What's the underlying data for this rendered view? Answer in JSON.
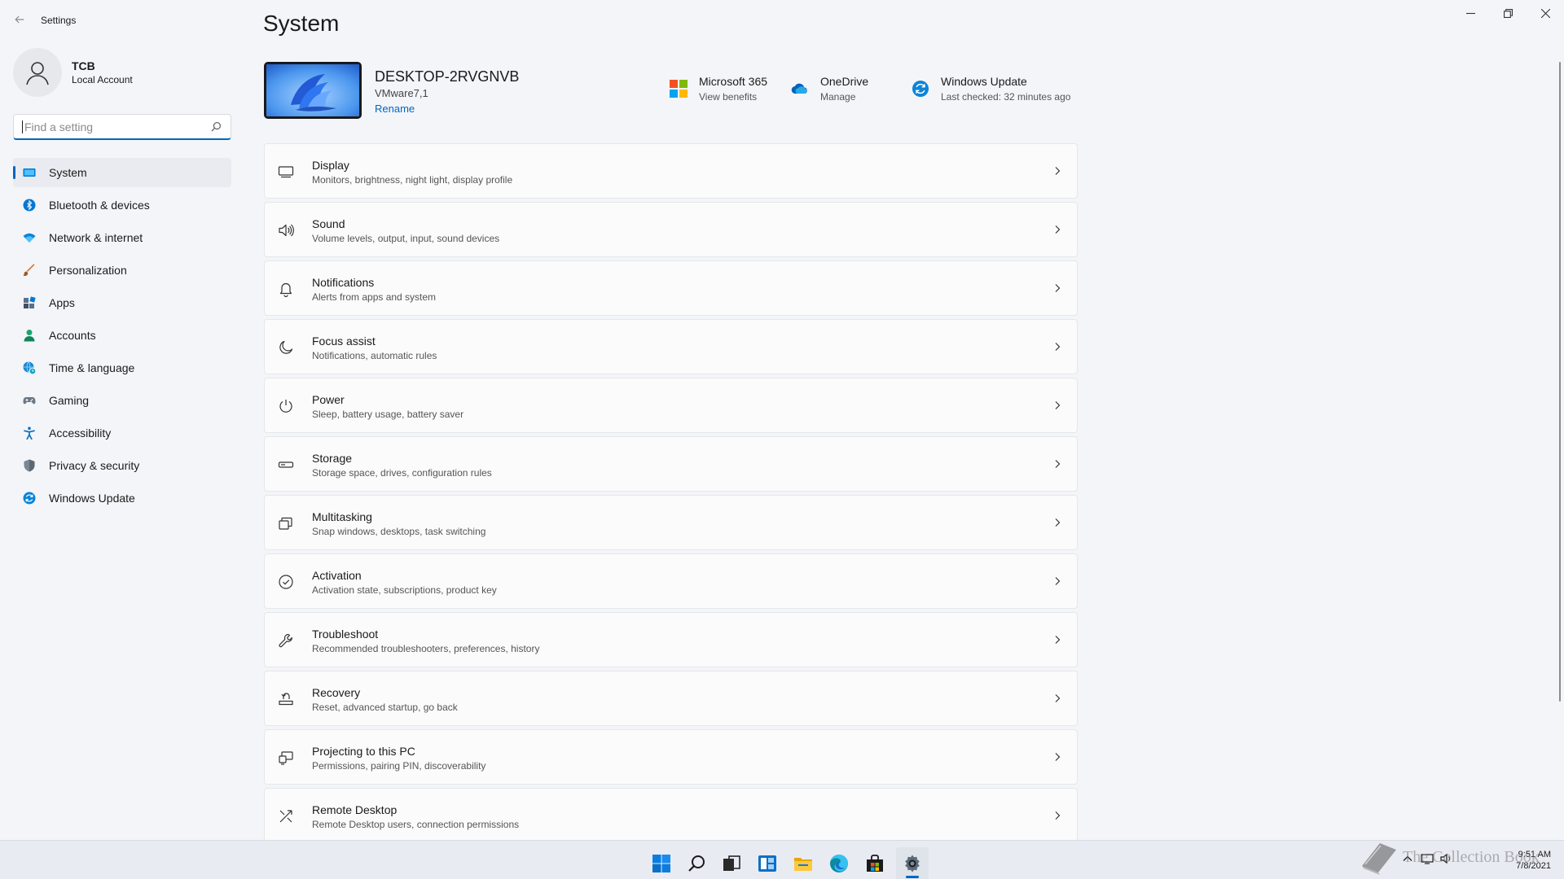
{
  "window": {
    "app_title": "Settings",
    "back_icon": "back-arrow-icon",
    "controls": [
      "minimize-icon",
      "restore-icon",
      "close-icon"
    ]
  },
  "profile": {
    "name": "TCB",
    "account_type": "Local Account",
    "icon": "user-avatar-icon"
  },
  "search": {
    "placeholder": "Find a setting",
    "icon": "search-icon"
  },
  "sidebar": {
    "items": [
      {
        "label": "System",
        "icon": "system-icon",
        "active": true
      },
      {
        "label": "Bluetooth & devices",
        "icon": "bluetooth-icon"
      },
      {
        "label": "Network & internet",
        "icon": "wifi-icon"
      },
      {
        "label": "Personalization",
        "icon": "brush-icon"
      },
      {
        "label": "Apps",
        "icon": "apps-icon"
      },
      {
        "label": "Accounts",
        "icon": "accounts-icon"
      },
      {
        "label": "Time & language",
        "icon": "globe-clock-icon"
      },
      {
        "label": "Gaming",
        "icon": "gamepad-icon"
      },
      {
        "label": "Accessibility",
        "icon": "accessibility-icon"
      },
      {
        "label": "Privacy & security",
        "icon": "shield-icon"
      },
      {
        "label": "Windows Update",
        "icon": "update-icon"
      }
    ]
  },
  "main": {
    "title": "System",
    "device": {
      "name": "DESKTOP-2RVGNVB",
      "model": "VMware7,1",
      "rename_link": "Rename"
    },
    "quick_links": [
      {
        "title": "Microsoft 365",
        "subtitle": "View benefits",
        "icon": "microsoft-365-icon"
      },
      {
        "title": "OneDrive",
        "subtitle": "Manage",
        "icon": "onedrive-icon"
      },
      {
        "title": "Windows Update",
        "subtitle": "Last checked: 32 minutes ago",
        "icon": "windows-update-icon"
      }
    ],
    "settings": [
      {
        "title": "Display",
        "subtitle": "Monitors, brightness, night light, display profile",
        "icon": "display-icon"
      },
      {
        "title": "Sound",
        "subtitle": "Volume levels, output, input, sound devices",
        "icon": "speaker-icon"
      },
      {
        "title": "Notifications",
        "subtitle": "Alerts from apps and system",
        "icon": "bell-icon"
      },
      {
        "title": "Focus assist",
        "subtitle": "Notifications, automatic rules",
        "icon": "moon-icon"
      },
      {
        "title": "Power",
        "subtitle": "Sleep, battery usage, battery saver",
        "icon": "power-icon"
      },
      {
        "title": "Storage",
        "subtitle": "Storage space, drives, configuration rules",
        "icon": "storage-icon"
      },
      {
        "title": "Multitasking",
        "subtitle": "Snap windows, desktops, task switching",
        "icon": "multitasking-icon"
      },
      {
        "title": "Activation",
        "subtitle": "Activation state, subscriptions, product key",
        "icon": "check-circle-icon"
      },
      {
        "title": "Troubleshoot",
        "subtitle": "Recommended troubleshooters, preferences, history",
        "icon": "wrench-icon"
      },
      {
        "title": "Recovery",
        "subtitle": "Reset, advanced startup, go back",
        "icon": "recovery-icon"
      },
      {
        "title": "Projecting to this PC",
        "subtitle": "Permissions, pairing PIN, discoverability",
        "icon": "projecting-icon"
      },
      {
        "title": "Remote Desktop",
        "subtitle": "Remote Desktop users, connection permissions",
        "icon": "remote-desktop-icon"
      }
    ]
  },
  "taskbar": {
    "apps": [
      "start-icon",
      "search-icon",
      "task-view-icon",
      "widgets-icon",
      "file-explorer-icon",
      "edge-icon",
      "store-icon",
      "settings-icon"
    ],
    "time": "9:51 AM",
    "date": "7/8/2021",
    "watermark_text": "The Collection Book"
  },
  "colors": {
    "accent": "#0067c0",
    "background": "#f3f5f9",
    "card": "#fbfbfc",
    "taskbar": "#e8ecf2"
  }
}
